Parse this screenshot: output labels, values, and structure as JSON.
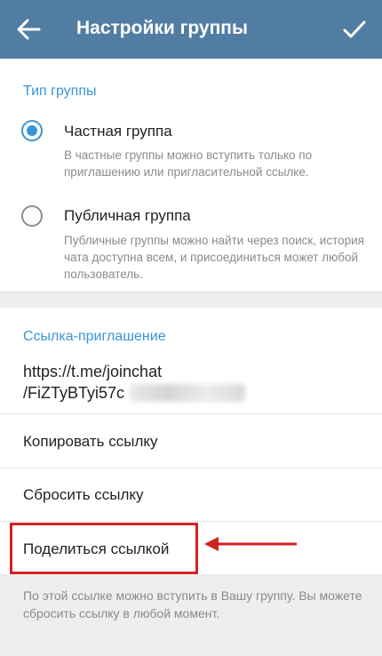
{
  "appbar": {
    "title": "Настройки группы",
    "back_icon": "arrow-left-icon",
    "confirm_icon": "checkmark-icon"
  },
  "group_type": {
    "header": "Тип группы",
    "options": [
      {
        "title": "Частная группа",
        "description": "В частные группы можно вступить только по приглашению или пригласительной ссылке.",
        "selected": true
      },
      {
        "title": "Публичная группа",
        "description": "Публичные группы можно найти через поиск, история чата доступна всем, и присоединиться может любой пользователь.",
        "selected": false
      }
    ]
  },
  "invite": {
    "header": "Ссылка-приглашение",
    "link_line1": "https://t.me/joinchat",
    "link_line2": "/FiZTyBTyi57c",
    "actions": {
      "copy": "Копировать ссылку",
      "reset": "Сбросить ссылку",
      "share": "Поделиться ссылкой"
    }
  },
  "footer": {
    "text": "По этой ссылке можно вступить в Вашу группу. Вы можете сбросить ссылку в любой момент."
  },
  "colors": {
    "appbar": "#527da3",
    "accent": "#3a95d5",
    "highlight": "#d32222"
  }
}
